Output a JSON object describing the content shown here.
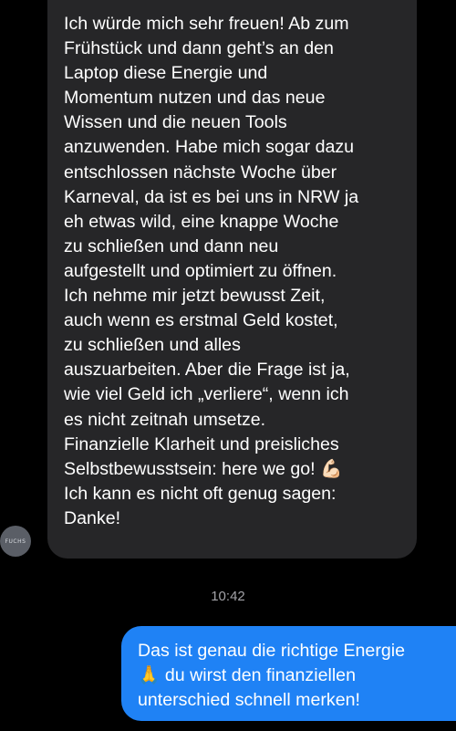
{
  "incoming_message": {
    "text": "Ich würde mich sehr freuen! Ab zum\nFrühstück und dann geht’s an den\nLaptop diese Energie und\nMomentum nutzen und das neue\nWissen und die neuen Tools\nanzuwenden. Habe mich sogar dazu\nentschlossen nächste Woche über\nKarneval, da ist es bei uns in NRW ja\neh etwas wild, eine knappe Woche\nzu schließen und dann neu\naufgestellt und optimiert zu öffnen.\nIch nehme mir jetzt bewusst Zeit,\nauch wenn es erstmal Geld kostet,\nzu schließen und alles\nauszuarbeiten. Aber die Frage ist ja,\nwie viel Geld ich „verliere“, wenn ich\nes nicht zeitnah umsetze.\nFinanzielle Klarheit und preisliches\nSelbstbewusstsein: here we go! 💪🏻\nIch kann es nicht oft genug sagen:\nDanke!"
  },
  "sender": {
    "avatar_text": "FUCHS"
  },
  "timestamp": "10:42",
  "outgoing_message": {
    "text": "Das ist genau die richtige Energie\n🙏 du wirst den finanziellen\nunterschied schnell merken!"
  },
  "colors": {
    "background": "#000000",
    "incoming_bubble": "#262628",
    "outgoing_bubble": "#1f82f5",
    "timestamp": "#a3a3a8"
  }
}
